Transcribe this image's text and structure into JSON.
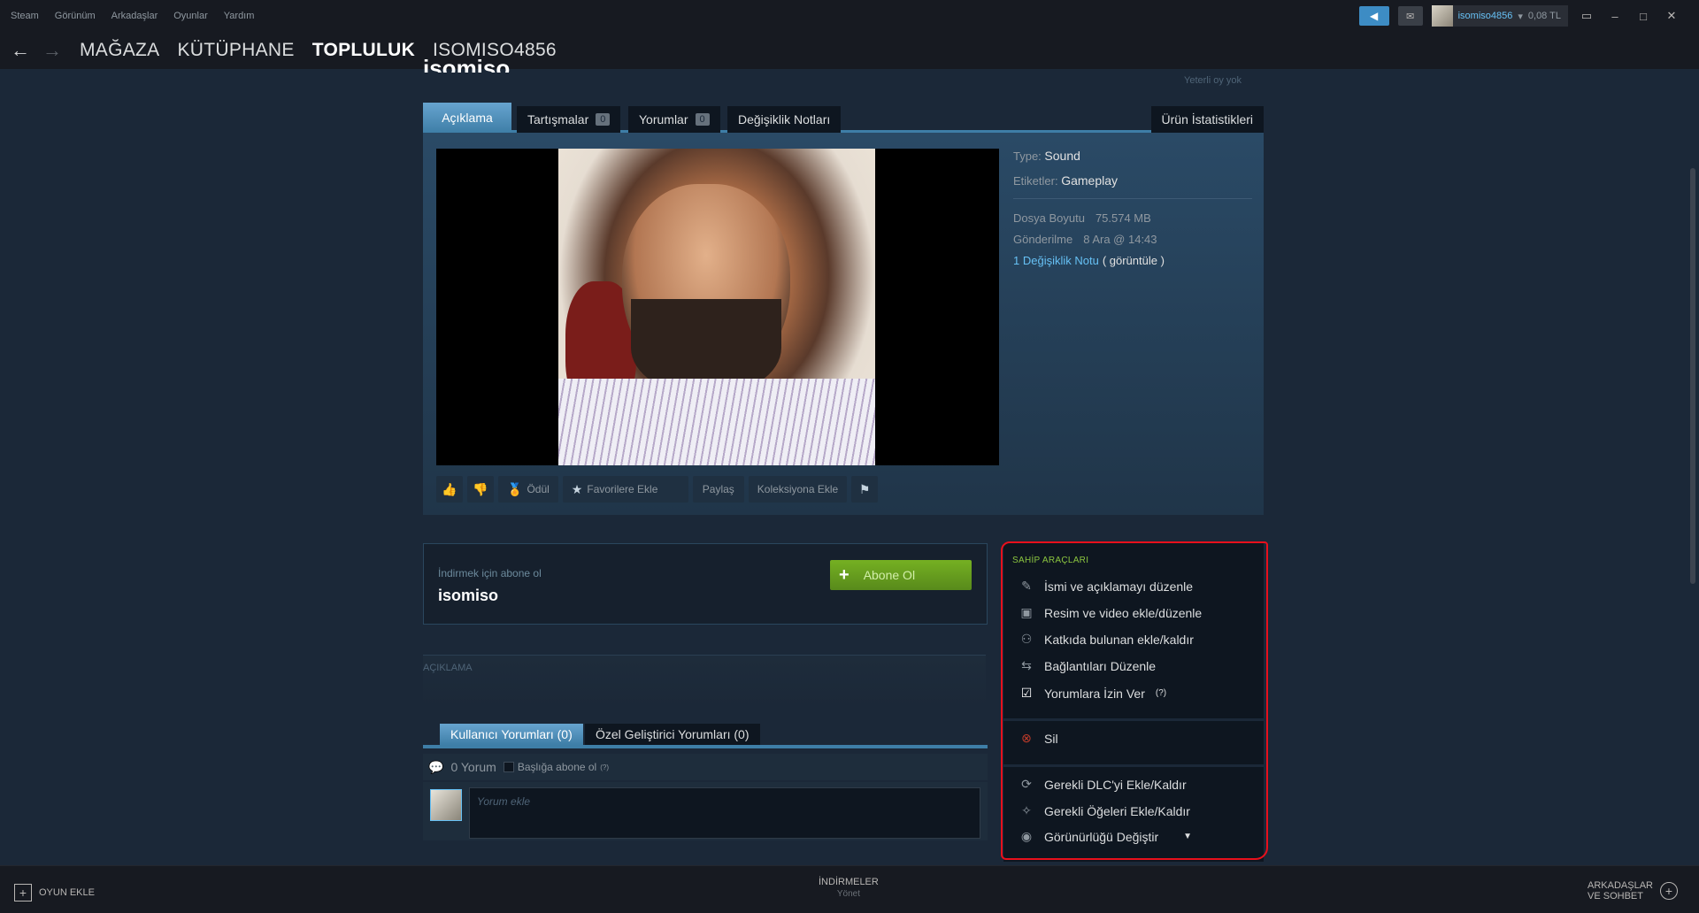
{
  "menu": [
    "Steam",
    "Görünüm",
    "Arkadaşlar",
    "Oyunlar",
    "Yardım"
  ],
  "user": {
    "name": "isomiso4856",
    "wallet": "0,08 TL"
  },
  "nav": {
    "links": [
      "MAĞAZA",
      "KÜTÜPHANE",
      "TOPLULUK",
      "ISOMISO4856"
    ]
  },
  "page": {
    "title_fragment": "isomiso",
    "rating_note": "Yeterli oy yok"
  },
  "tabs": {
    "description": "Açıklama",
    "discussions": "Tartışmalar",
    "discussions_count": "0",
    "comments": "Yorumlar",
    "comments_count": "0",
    "changelog": "Değişiklik Notları",
    "stats": "Ürün İstatistikleri"
  },
  "meta": {
    "type_label": "Type:",
    "type_value": "Sound",
    "tags_label": "Etiketler:",
    "tags_value": "Gameplay",
    "size_label": "Dosya Boyutu",
    "size_value": "75.574 MB",
    "posted_label": "Gönderilme",
    "posted_value": "8 Ara @ 14:43",
    "changenote_link": "1 Değişiklik Notu",
    "changenote_view": "( görüntüle )"
  },
  "actions": {
    "award": "Ödül",
    "favorite": "Favorilere Ekle",
    "share": "Paylaş",
    "collection": "Koleksiyona Ekle"
  },
  "subscribe": {
    "hint": "İndirmek için abone ol",
    "name": "isomiso",
    "button": "Abone Ol"
  },
  "description": {
    "label": "AÇIKLAMA"
  },
  "comments": {
    "user_tab": "Kullanıcı Yorumları (0)",
    "dev_tab": "Özel Geliştirici Yorumları (0)",
    "count": "0 Yorum",
    "subscribe_thread": "Başlığa abone ol",
    "help": "(?)",
    "placeholder": "Yorum ekle"
  },
  "owner": {
    "title": "SAHİP ARAÇLARI",
    "items": [
      "İsmi ve açıklamayı düzenle",
      "Resim ve video ekle/düzenle",
      "Katkıda bulunan ekle/kaldır",
      "Bağlantıları Düzenle",
      "Yorumlara İzin Ver"
    ],
    "allow_help": "(?)",
    "delete": "Sil",
    "items2": [
      "Gerekli DLC'yi Ekle/Kaldır",
      "Gerekli Öğeleri Ekle/Kaldır",
      "Görünürlüğü Değiştir"
    ]
  },
  "footer": {
    "add_game": "OYUN EKLE",
    "downloads": "İNDİRMELER",
    "downloads_sub": "Yönet",
    "friends_line1": "ARKADAŞLAR",
    "friends_line2": "VE SOHBET"
  }
}
